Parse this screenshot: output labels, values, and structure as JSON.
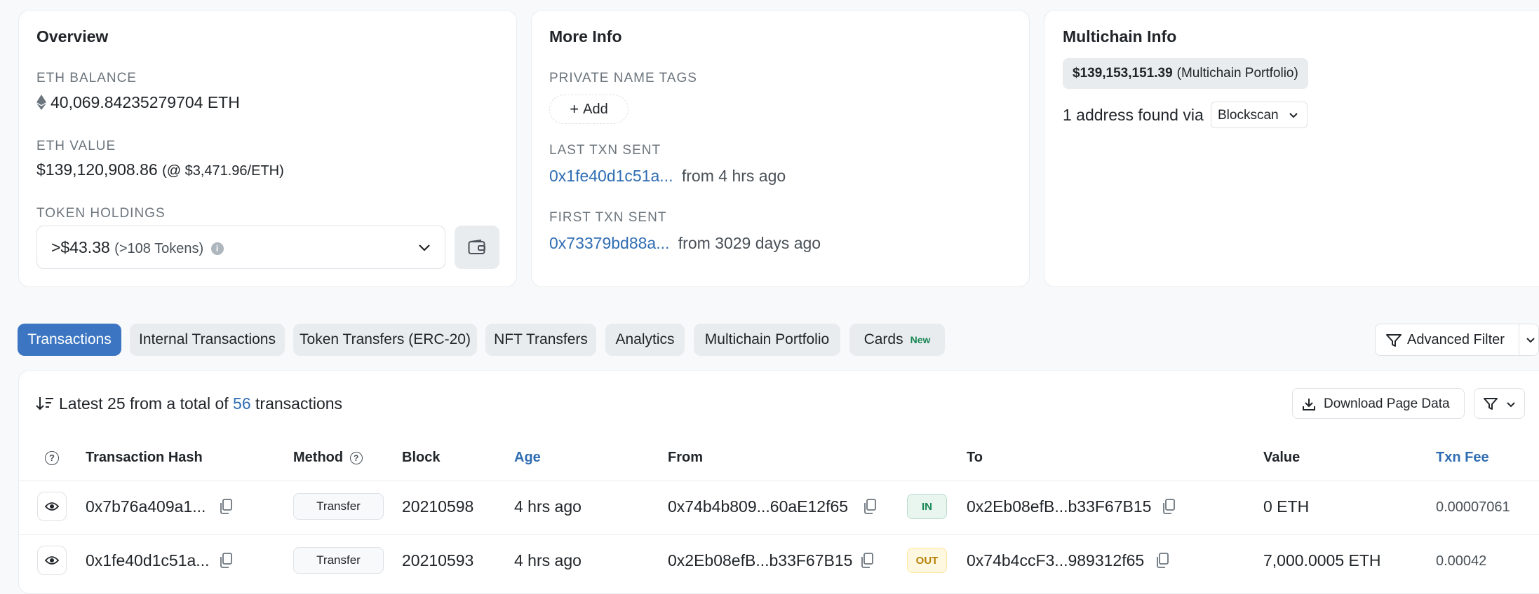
{
  "overview": {
    "title": "Overview",
    "eth_balance_label": "ETH BALANCE",
    "eth_balance_value": "40,069.84235279704 ETH",
    "eth_value_label": "ETH VALUE",
    "eth_value_amount": "$139,120,908.86",
    "eth_value_rate": "(@ $3,471.96/ETH)",
    "token_holdings_label": "TOKEN HOLDINGS",
    "token_value": ">$43.38",
    "token_count": "(>108 Tokens)"
  },
  "more_info": {
    "title": "More Info",
    "private_tags_label": "PRIVATE NAME TAGS",
    "add_label": "Add",
    "last_txn_label": "LAST TXN SENT",
    "last_txn_hash": "0x1fe40d1c51a...",
    "last_txn_age": "from 4 hrs ago",
    "first_txn_label": "FIRST TXN SENT",
    "first_txn_hash": "0x73379bd88a...",
    "first_txn_age": "from 3029 days ago"
  },
  "multichain": {
    "title": "Multichain Info",
    "portfolio_value": "$139,153,151.39",
    "portfolio_suffix": "(Multichain Portfolio)",
    "found_text": "1 address found via",
    "source_select": "Blockscan"
  },
  "tabs": [
    {
      "label": "Transactions"
    },
    {
      "label": "Internal Transactions"
    },
    {
      "label": "Token Transfers (ERC-20)"
    },
    {
      "label": "NFT Transfers"
    },
    {
      "label": "Analytics"
    },
    {
      "label": "Multichain Portfolio"
    },
    {
      "label": "Cards",
      "badge": "New"
    }
  ],
  "advanced_filter_label": "Advanced Filter",
  "summary": {
    "prefix": "Latest 25 from a total of",
    "count": "56",
    "suffix": "transactions",
    "download_label": "Download Page Data"
  },
  "table": {
    "headers": {
      "hash": "Transaction Hash",
      "method": "Method",
      "block": "Block",
      "age": "Age",
      "from": "From",
      "to": "To",
      "value": "Value",
      "fee": "Txn Fee"
    },
    "rows": [
      {
        "hash": "0x7b76a409a1...",
        "method": "Transfer",
        "block": "20210598",
        "age": "4 hrs ago",
        "from": "0x74b4b809...60aE12f65",
        "direction": "IN",
        "to": "0x2Eb08efB...b33F67B15",
        "value": "0 ETH",
        "fee": "0.00007061"
      },
      {
        "hash": "0x1fe40d1c51a...",
        "method": "Transfer",
        "block": "20210593",
        "age": "4 hrs ago",
        "from": "0x2Eb08efB...b33F67B15",
        "direction": "OUT",
        "to": "0x74b4ccF3...989312f65",
        "value": "7,000.0005 ETH",
        "fee": "0.00042"
      }
    ]
  },
  "colors": {
    "accent": "#3c76c2",
    "link": "#2f6db2",
    "in_badge": "#198754",
    "out_badge": "#b58105"
  }
}
